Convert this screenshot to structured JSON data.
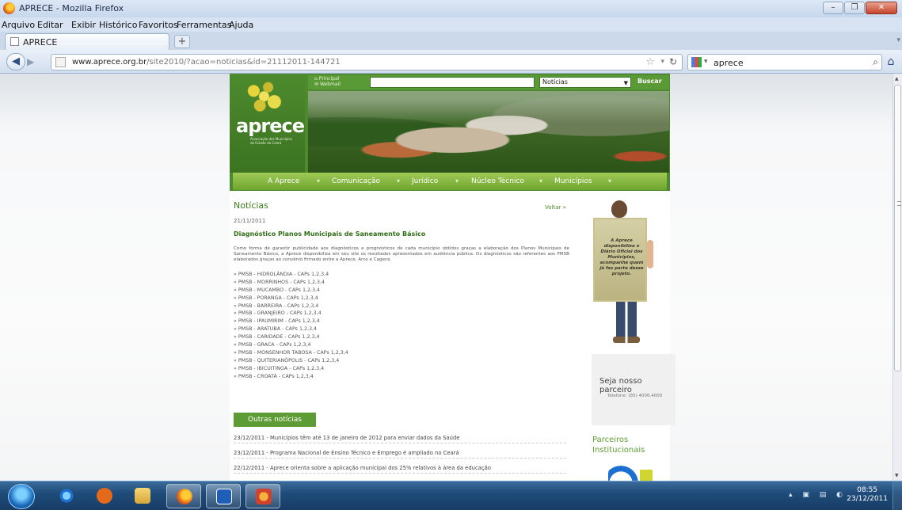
{
  "window": {
    "title": "APRECE - Mozilla Firefox"
  },
  "menu": [
    "Arquivo",
    "Editar",
    "Exibir",
    "Histórico",
    "Favoritos",
    "Ferramentas",
    "Ajuda"
  ],
  "tab": {
    "label": "APRECE"
  },
  "url": {
    "host": "www.aprece.org.br",
    "path": "/site2010/?acao=noticias&id=21112011-144721"
  },
  "search": {
    "value": "aprece"
  },
  "site": {
    "logo": "aprece",
    "top_links": [
      "Principal",
      "Webmail"
    ],
    "search_select": "Notícias",
    "search_button": "Buscar",
    "nav": [
      "A Aprece",
      "Comunicação",
      "Jurídico",
      "Núcleo Técnico",
      "Municípios"
    ],
    "section_title": "Notícias",
    "voltar": "Voltar »",
    "date": "21/11/2011",
    "news_title": "Diagnóstico Planos Municipais de Saneamento Básico",
    "body": "Como forma de garantir publicidade aos diagnósticos e prognósticos de cada município obtidos graças a elaboração dos Planos Municipais de Saneamento Básico, a Aprece disponibiliza em seu site os resultados apresentados em audiência pública. Os diagnósticos são referentes aos PMSB elaborados graças ao convênio firmado entre a Aprece, Arce e Cagece.",
    "pmsb": [
      "» PMSB - HIDROLÂNDIA - CAPs 1,2,3,4",
      "» PMSB - MORRINHOS - CAPs 1,2,3,4",
      "» PMSB - MUCAMBO - CAPs 1,2,3,4",
      "» PMSB - PORANGA - CAPs 1,2,3,4",
      "» PMSB - BARREIRA - CAPs 1,2,3,4",
      "» PMSB - GRANJEIRO - CAPs 1,2,3,4",
      "» PMSB - IPAUMIRIM - CAPs 1,2,3,4",
      "» PMSB - ARATUBA - CAPs 1,2,3,4",
      "» PMSB - CARIDADE - CAPs 1,2,3,4",
      "» PMSB - GRACA - CAPs 1,2,3,4",
      "» PMSB - MONSENHOR TABOSA - CAPs 1,2,3,4",
      "» PMSB - QUITERIANÓPOLIS - CAPs 1,2,3,4",
      "» PMSB - IBICUITINGA - CAPs 1,2,3,4",
      "» PMSB - CROATÁ - CAPs 1,2,3,4"
    ],
    "outras_noticias": "Outras notícias",
    "other_news": [
      "23/12/2011 - Municípios têm até 13 de janeiro de 2012 para enviar dados da Saúde",
      "23/12/2011 - Programa Nacional de Ensino Técnico e Emprego é ampliado no Ceará",
      "22/12/2011 - Aprece orienta sobre a aplicação municipal dos 25% relativos à área da educação"
    ],
    "banner_text": "A Aprece disponibiliza o Diário Oficial dos Municípios, acompanhe quem já faz parte desse projeto.",
    "parceiro_title": "Seja nosso parceiro",
    "parceiro_phone": "Telefone: (85) 4006.4000",
    "parceiros_inst_1": "Parceiros",
    "parceiros_inst_2": "Institucionais"
  },
  "taskbar": {
    "time": "08:55",
    "date": "23/12/2011"
  }
}
